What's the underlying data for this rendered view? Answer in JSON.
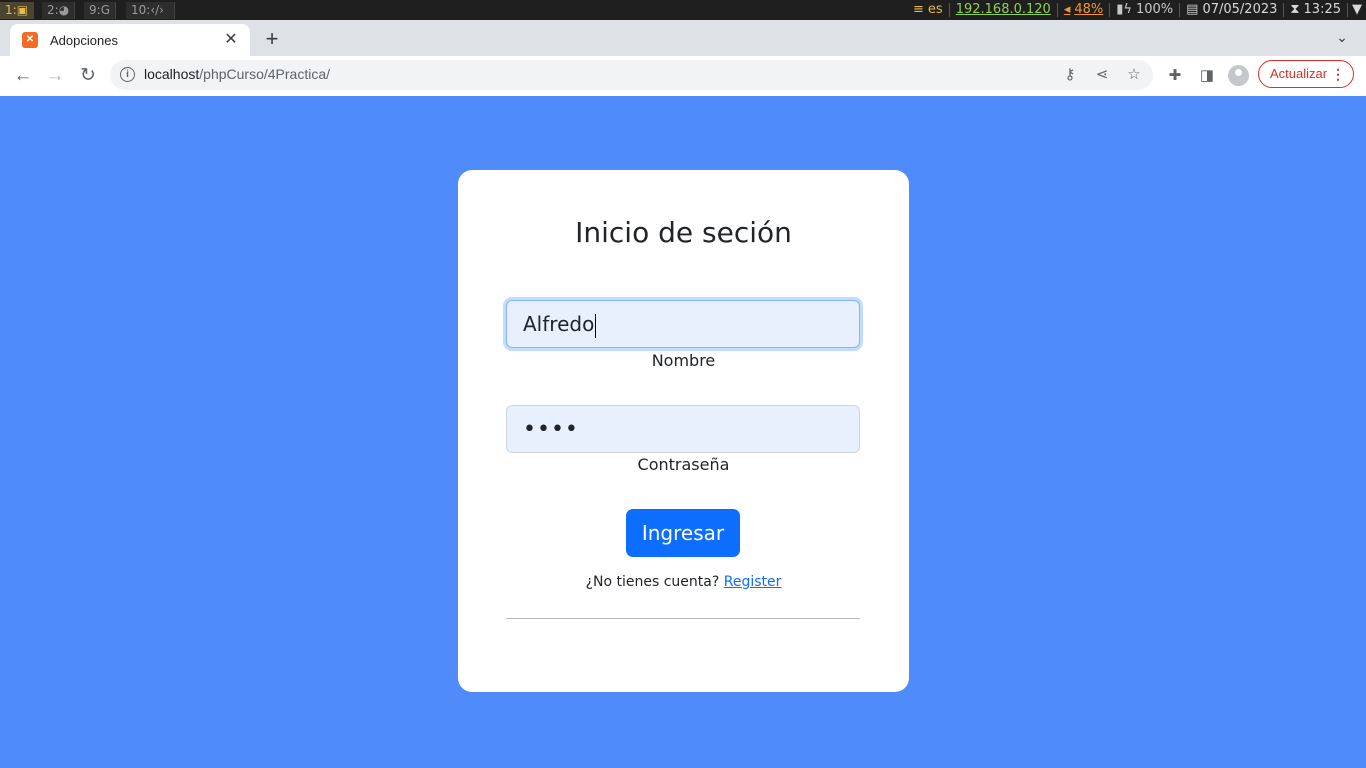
{
  "system_bar": {
    "workspaces": [
      {
        "label": "1:",
        "icon": "terminal-icon",
        "glyph": "▣",
        "active": true
      },
      {
        "label": "2:",
        "icon": "firefox-icon",
        "glyph": "◕",
        "active": false
      },
      {
        "label": "9:",
        "icon": "chrome-icon",
        "glyph": "G",
        "active": false
      },
      {
        "label": "10:",
        "icon": "code-icon",
        "glyph": "‹/›",
        "active": false
      }
    ],
    "keyboard_layout": "es",
    "ip_address": "192.168.0.120",
    "volume": "48%",
    "battery": "100%",
    "date": "07/05/2023",
    "time": "13:25"
  },
  "browser": {
    "tab_title": "Adopciones",
    "url_host": "localhost",
    "url_path": "/phpCurso/4Practica/",
    "update_label": "Actualizar"
  },
  "login": {
    "title": "Inicio de seción",
    "username_value": "Alfredo",
    "username_label": "Nombre",
    "password_mask": "••••",
    "password_label": "Contraseña",
    "submit_label": "Ingresar",
    "register_prompt": "¿No tienes cuenta?",
    "register_link": "Register"
  },
  "colors": {
    "page_background": "#4f8bfb",
    "primary_button": "#0d6efd",
    "input_autofill": "#e8f0fe"
  }
}
